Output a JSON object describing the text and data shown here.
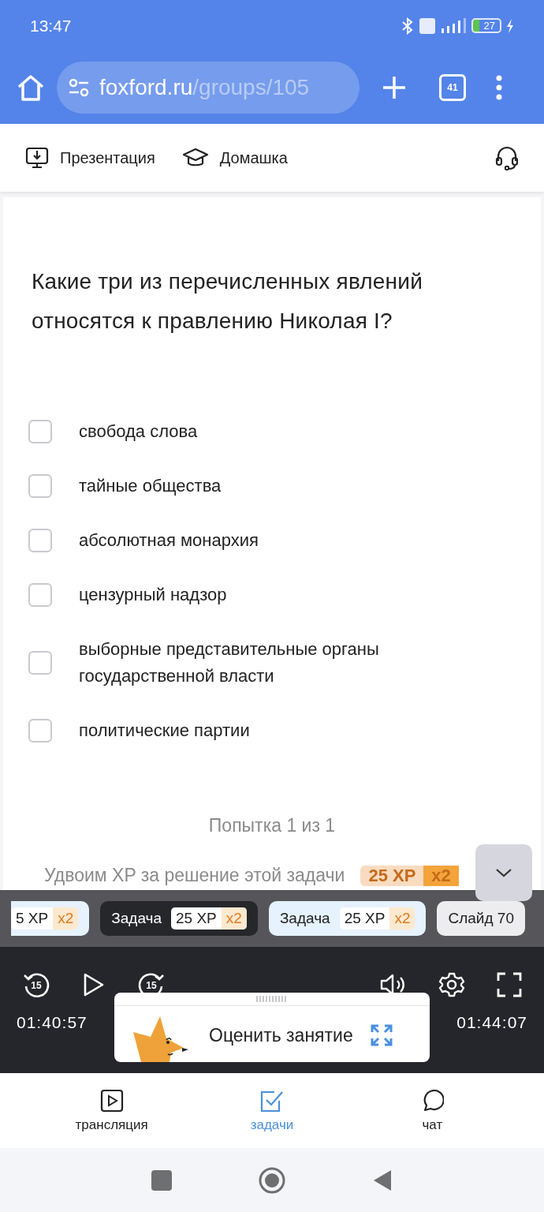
{
  "status_bar": {
    "time": "13:47",
    "battery": "27"
  },
  "browser": {
    "url_domain": "foxford.ru",
    "url_path": "/groups/105",
    "tab_count": "41"
  },
  "toolbar": {
    "items": [
      {
        "kind": "presentation",
        "label": "Презентация"
      },
      {
        "kind": "homework",
        "label": "Домашка"
      }
    ]
  },
  "question": {
    "text": "Какие три из перечисленных явлений относятся к правлению Николая I?",
    "options": [
      {
        "label": "свобода слова",
        "checked": false
      },
      {
        "label": "тайные общества",
        "checked": false
      },
      {
        "label": "абсолютная монархия",
        "checked": false
      },
      {
        "label": "цензурный надзор",
        "checked": false
      },
      {
        "label": "выборные представительные органы государственной власти",
        "checked": false
      },
      {
        "label": "политические партии",
        "checked": false
      }
    ],
    "attempt": "Попытка 1 из 1",
    "bonus": {
      "text": "Удвоим XP за решение этой задачи",
      "xp": "25 XP",
      "multiplier": "x2"
    }
  },
  "chips": [
    {
      "kind": "task",
      "xp": "5 XP",
      "multiplier": "x2",
      "selected": false
    },
    {
      "kind": "task",
      "label": "Задача",
      "xp": "25 XP",
      "multiplier": "x2",
      "selected": true
    },
    {
      "kind": "task",
      "label": "Задача",
      "xp": "25 XP",
      "multiplier": "x2",
      "selected": false
    },
    {
      "kind": "slide",
      "label": "Слайд 70",
      "selected": false
    }
  ],
  "player": {
    "elapsed": "01:40:57",
    "total": "01:44:07",
    "rewind": "15",
    "forward": "15"
  },
  "rating_popup": {
    "label": "Оценить занятие"
  },
  "bottom_nav": [
    {
      "kind": "video",
      "label": "трансляция",
      "selected": false
    },
    {
      "kind": "tasks",
      "label": "задачи",
      "selected": true
    },
    {
      "kind": "chat",
      "label": "чат",
      "selected": false
    }
  ]
}
